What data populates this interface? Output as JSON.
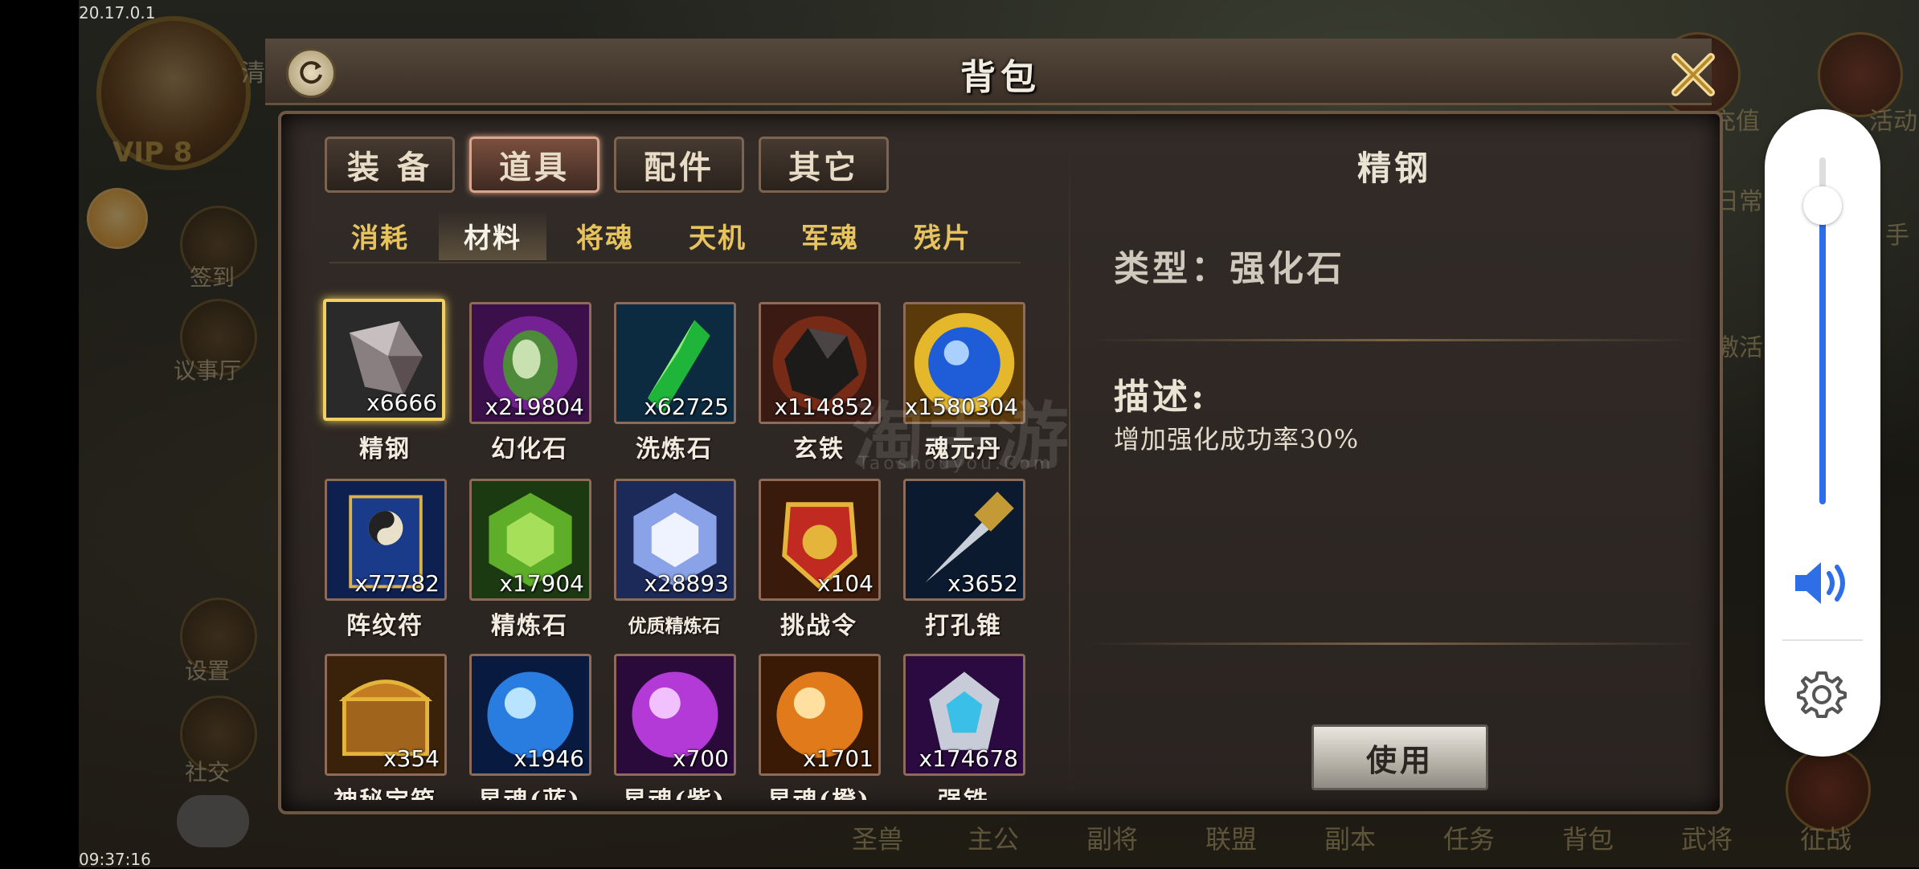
{
  "debug": {
    "top_text": "20.17.0.1",
    "bottom_text": "09:37:16"
  },
  "hud_left": {
    "vip": "VIP 8",
    "truncated_text": "清",
    "buttons": [
      "签到",
      "议事厅",
      "设置",
      "社交"
    ]
  },
  "hud_right": {
    "buttons": [
      "充值",
      "活动",
      "日常",
      "手",
      "激活"
    ],
    "bottom_nav": [
      "圣兽",
      "主公",
      "副将",
      "联盟",
      "副本",
      "任务",
      "背包",
      "武将",
      "征战"
    ]
  },
  "panel": {
    "title": "背包",
    "main_tabs": [
      {
        "label": "装 备",
        "active": false
      },
      {
        "label": "道具",
        "active": true
      },
      {
        "label": "配件",
        "active": false
      },
      {
        "label": "其它",
        "active": false
      }
    ],
    "sub_tabs": [
      {
        "label": "消耗",
        "active": false
      },
      {
        "label": "材料",
        "active": true
      },
      {
        "label": "将魂",
        "active": false
      },
      {
        "label": "天机",
        "active": false
      },
      {
        "label": "军魂",
        "active": false
      },
      {
        "label": "残片",
        "active": false
      }
    ],
    "items": [
      {
        "name": "精钢",
        "qty": "x6666",
        "selected": true,
        "art": "gray-crystal"
      },
      {
        "name": "幻化石",
        "qty": "x219804",
        "art": "purple-stone"
      },
      {
        "name": "洗炼石",
        "qty": "x62725",
        "art": "green-crystal"
      },
      {
        "name": "玄铁",
        "qty": "x114852",
        "art": "black-ore"
      },
      {
        "name": "魂元丹",
        "qty": "x1580304",
        "art": "blue-orb"
      },
      {
        "name": "阵纹符",
        "qty": "x77782",
        "art": "scroll"
      },
      {
        "name": "精炼石",
        "qty": "x17904",
        "art": "green-gem"
      },
      {
        "name": "优质精炼石",
        "qty": "x28893",
        "art": "white-gem"
      },
      {
        "name": "挑战令",
        "qty": "x104",
        "art": "token"
      },
      {
        "name": "打孔锥",
        "qty": "x3652",
        "art": "awl"
      },
      {
        "name": "神秘宝箱",
        "qty": "x354",
        "art": "chest"
      },
      {
        "name": "星魂(蓝)",
        "qty": "x1946",
        "art": "blue-star-orb"
      },
      {
        "name": "星魂(紫)",
        "qty": "x700",
        "art": "purple-star-orb"
      },
      {
        "name": "星魂(橙)",
        "qty": "x1701",
        "art": "orange-star-orb"
      },
      {
        "name": "强铁",
        "qty": "x174678",
        "art": "silver-gem"
      }
    ],
    "detail": {
      "name": "精钢",
      "type_text": "类型：强化石",
      "desc_label": "描述:",
      "desc_text": "增加强化成功率30%",
      "use_label": "使用"
    }
  },
  "watermark": {
    "main": "淘手游",
    "sub": "Taoshouyou.Com"
  },
  "volume": {
    "level": 0.86,
    "accent": "#2e6ee6"
  }
}
